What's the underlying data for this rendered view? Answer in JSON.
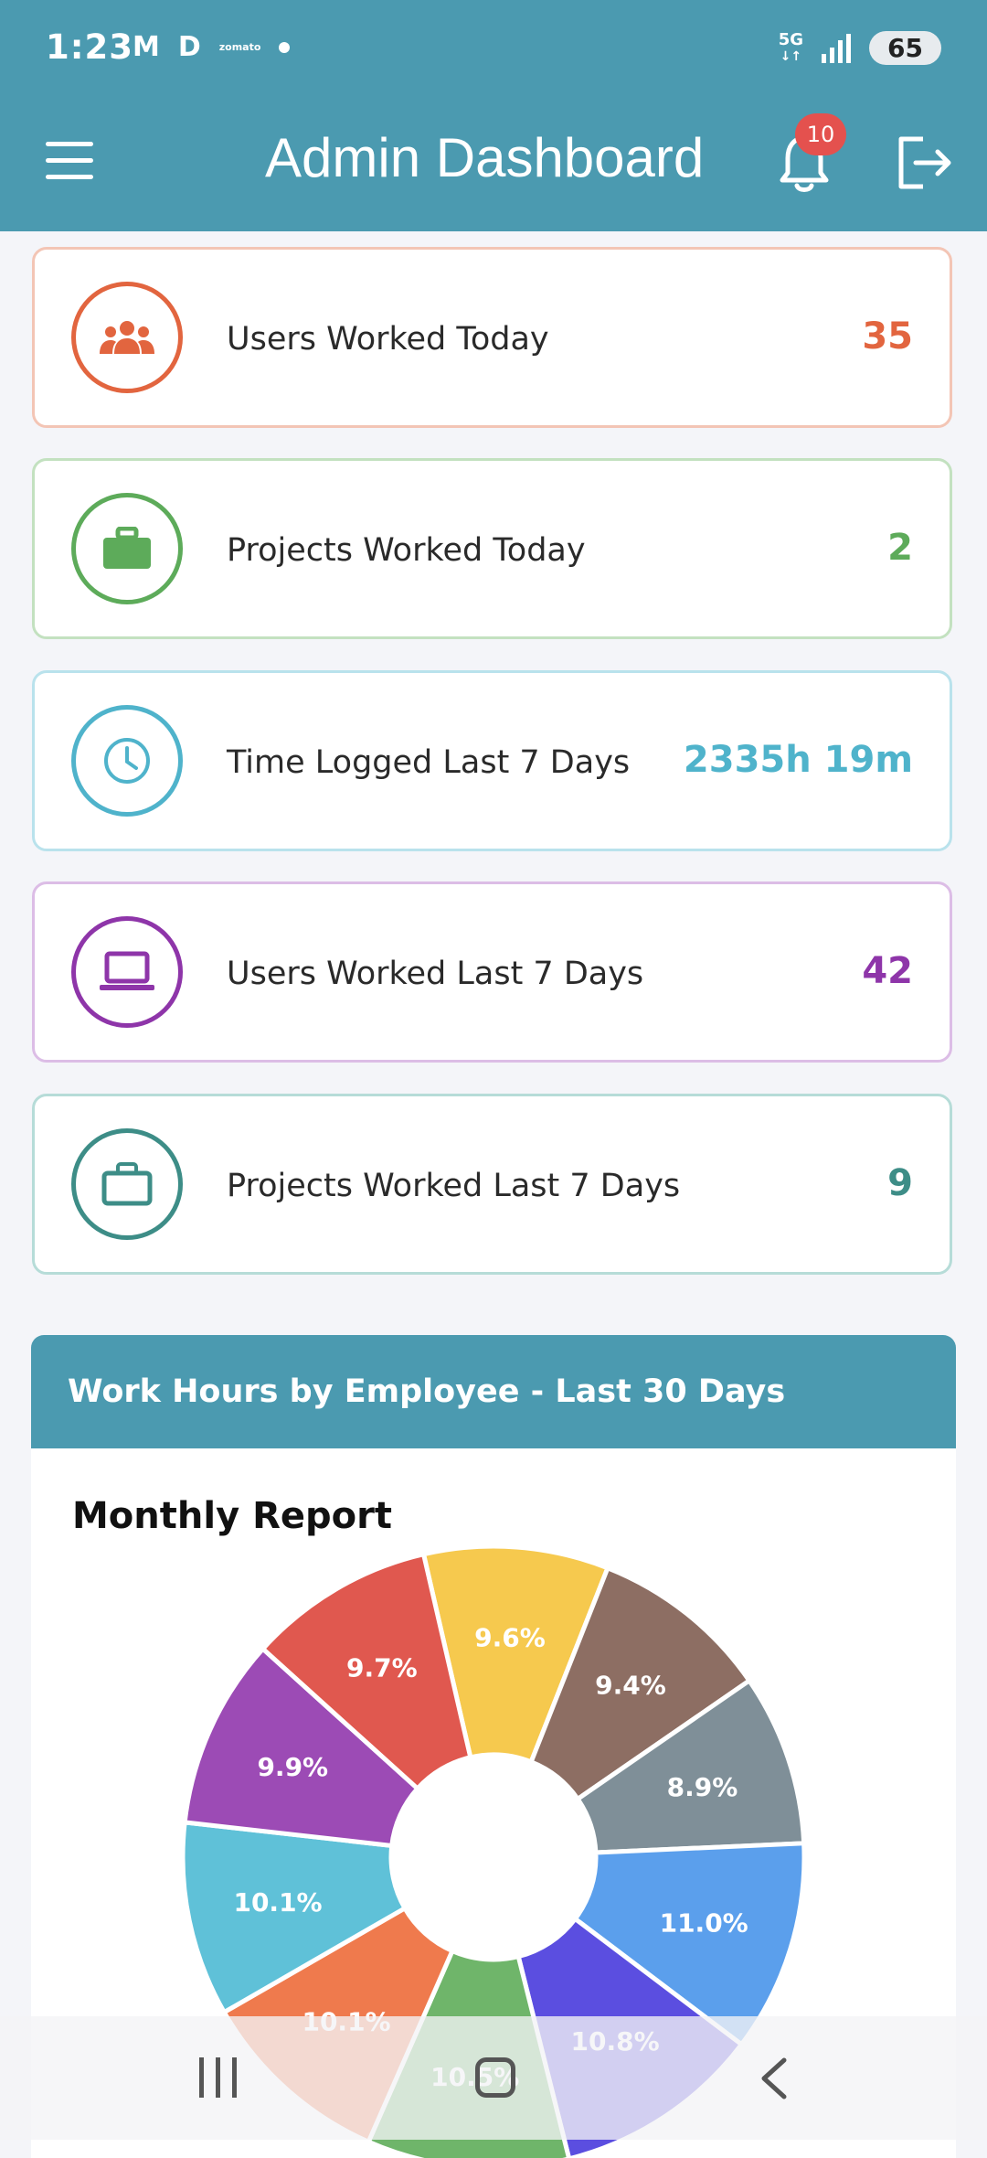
{
  "status_bar": {
    "time": "1:23",
    "app_glyph_1": "M",
    "app_glyph_2": "D",
    "app_small": "zomato",
    "network": "5G",
    "battery": "65"
  },
  "header": {
    "title": "Admin Dashboard",
    "notification_count": "10"
  },
  "cards": [
    {
      "label": "Users Worked Today",
      "value": "35",
      "color": "#e2653f",
      "icon": "users-icon"
    },
    {
      "label": "Projects Worked Today",
      "value": "2",
      "color": "#5dab5a",
      "icon": "briefcase-icon"
    },
    {
      "label": "Time Logged Last 7 Days",
      "value": "2335h 19m",
      "color": "#4fb3cb",
      "icon": "clock-icon"
    },
    {
      "label": "Users Worked Last 7 Days",
      "value": "42",
      "color": "#8e35a9",
      "icon": "laptop-icon"
    },
    {
      "label": "Projects Worked Last 7 Days",
      "value": "9",
      "color": "#3d8d87",
      "icon": "briefcase-outline-icon"
    }
  ],
  "chart_panel": {
    "header": "Work Hours by Employee - Last 30 Days",
    "report_title": "Monthly Report"
  },
  "chart_data": {
    "type": "pie",
    "title": "Monthly Report",
    "slices": [
      {
        "label": "9.6%",
        "value": 9.6,
        "color": "#f6c94e"
      },
      {
        "label": "9.4%",
        "value": 9.4,
        "color": "#8d6e63"
      },
      {
        "label": "8.9%",
        "value": 8.9,
        "color": "#7f8f98"
      },
      {
        "label": "11.0%",
        "value": 11.0,
        "color": "#5b9fec"
      },
      {
        "label": "10.8%",
        "value": 10.8,
        "color": "#5b4ee0"
      },
      {
        "label": "10.5%",
        "value": 10.5,
        "color": "#6fb56a"
      },
      {
        "label": "10.1%",
        "value": 10.1,
        "color": "#ef7a4d"
      },
      {
        "label": "10.1%",
        "value": 10.1,
        "color": "#5fc1d8"
      },
      {
        "label": "9.9%",
        "value": 9.9,
        "color": "#9c4bb5"
      },
      {
        "label": "9.7%",
        "value": 9.7,
        "color": "#e0584f"
      }
    ]
  }
}
